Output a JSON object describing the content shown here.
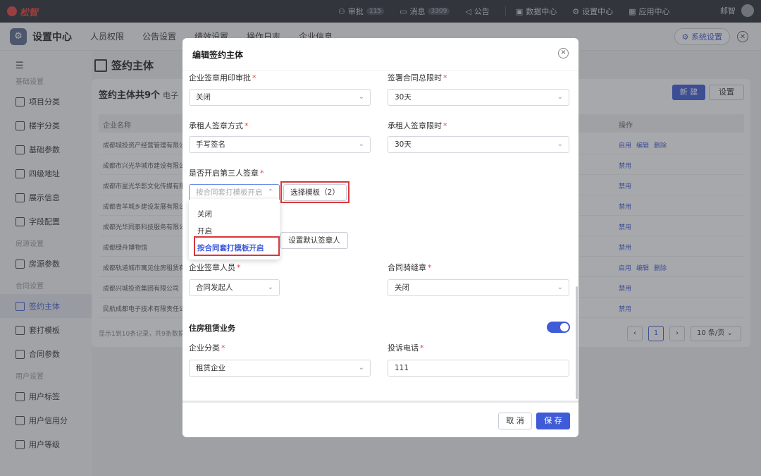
{
  "topbar": {
    "logo": "松智",
    "items": [
      {
        "label": "审批",
        "badge": "115",
        "icon": "person-icon"
      },
      {
        "label": "消息",
        "badge": "3309",
        "icon": "message-icon"
      },
      {
        "label": "公告",
        "badge": "",
        "icon": "megaphone-icon"
      },
      {
        "label": "数据中心",
        "badge": "",
        "icon": "monitor-icon"
      },
      {
        "label": "设置中心",
        "badge": "",
        "icon": "gear-icon"
      },
      {
        "label": "应用中心",
        "badge": "",
        "icon": "apps-icon"
      }
    ],
    "user_name": "邮智"
  },
  "subheader": {
    "app_title": "设置中心",
    "tabs": [
      "人员权限",
      "公告设置",
      "绩效设置",
      "操作日志",
      "企业信息"
    ],
    "system_settings": "系统设置"
  },
  "sidebar": {
    "groups": [
      {
        "title": "基础设置",
        "items": [
          "项目分类",
          "楼宇分类",
          "基础参数",
          "四级地址",
          "展示信息",
          "字段配置"
        ]
      },
      {
        "title": "房源设置",
        "items": [
          "房源参数"
        ]
      },
      {
        "title": "合同设置",
        "items": [
          "签约主体",
          "套打模板",
          "合同参数"
        ]
      },
      {
        "title": "用户设置",
        "items": [
          "用户标签",
          "用户信用分",
          "用户等级"
        ]
      }
    ],
    "active": "签约主体"
  },
  "main": {
    "page_title": "签约主体",
    "count_title": "签约主体共9个",
    "count_sub": "电子",
    "new_button": "新 建",
    "settings_button": "设置",
    "col_name": "企业名称",
    "col_ops": "操作",
    "rows": [
      {
        "name": "成都城投资产经营管理有限公",
        "ops": [
          "启用",
          "编辑",
          "删除"
        ]
      },
      {
        "name": "成都市兴光华城市建设有限公",
        "ops": [
          "禁用"
        ]
      },
      {
        "name": "成都市星光华影文化传媒有限",
        "ops": [
          "禁用"
        ]
      },
      {
        "name": "成都青羊城乡建设发展有限公",
        "ops": [
          "禁用"
        ]
      },
      {
        "name": "成都光华同泰科技服务有限公",
        "ops": [
          "禁用"
        ]
      },
      {
        "name": "成都绿舟博物馆",
        "ops": [
          "禁用"
        ]
      },
      {
        "name": "成都轨道城市寓见住房租赁有",
        "ops": [
          "启用",
          "编辑",
          "删除"
        ]
      },
      {
        "name": "成都兴城投资集团有限公司",
        "ops": [
          "禁用"
        ]
      },
      {
        "name": "民航成都电子技术有限责任公",
        "ops": [
          "禁用"
        ]
      }
    ],
    "pager_info": "显示1到10条记录，共9条数据",
    "current_page": "1",
    "page_size": "10 条/页"
  },
  "modal": {
    "title": "编辑签约主体",
    "fields": {
      "seal_approval": {
        "label": "企业签章用印审批",
        "value": "关闭"
      },
      "total_limit": {
        "label": "签署合同总限时",
        "value": "30天"
      },
      "tenant_method": {
        "label": "承租人签章方式",
        "value": "手写签名"
      },
      "tenant_limit": {
        "label": "承租人签章限时",
        "value": "30天"
      },
      "third_party": {
        "label": "是否开启第三人签章",
        "placeholder": "按合同套打模板开启"
      },
      "choose_template": "选择模板（2）",
      "default_signer": "设置默认签章人",
      "enterprise_signer": {
        "label": "企业签章人员",
        "value": "合同发起人"
      },
      "seam_seal": {
        "label": "合同骑缝章",
        "value": "关闭"
      },
      "section_title": "住房租赁业务",
      "category": {
        "label": "企业分类",
        "value": "租赁企业"
      },
      "phone": {
        "label": "投诉电话",
        "value": "111"
      }
    },
    "dropdown_options": [
      "关闭",
      "开启",
      "按合同套打模板开启"
    ],
    "dropdown_selected": "按合同套打模板开启",
    "cancel": "取 消",
    "save": "保 存"
  }
}
